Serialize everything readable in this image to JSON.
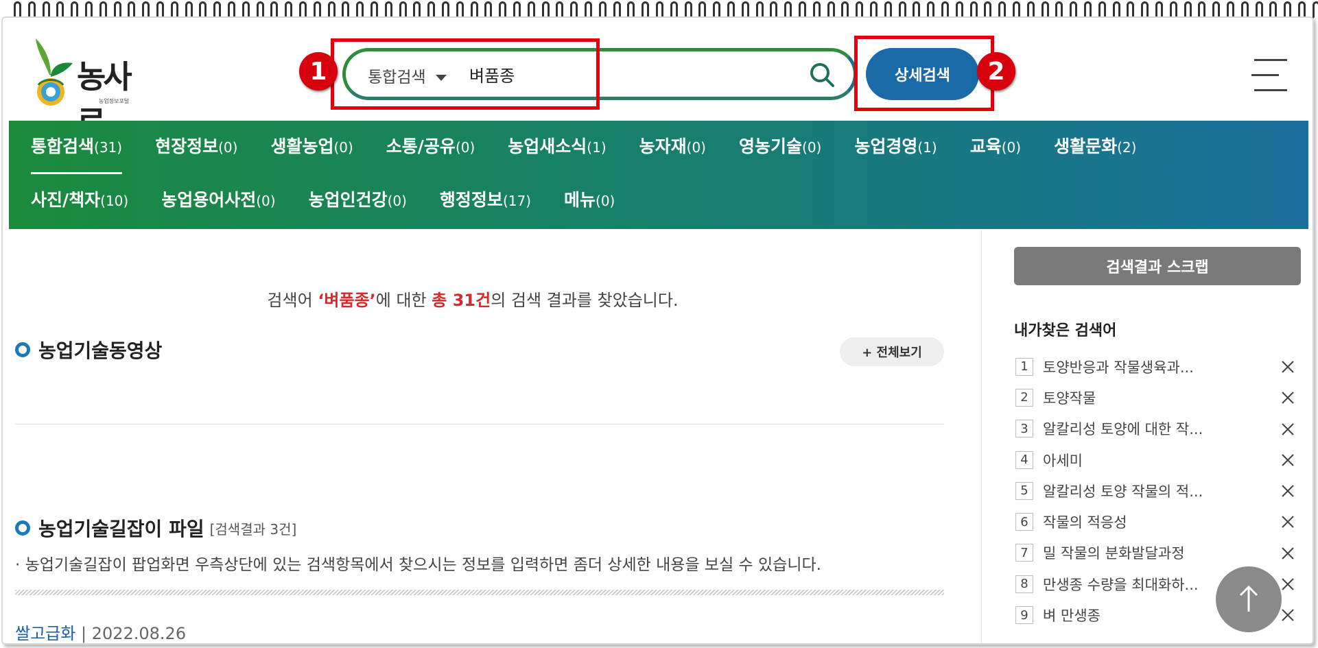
{
  "logo": {
    "text": "농사로",
    "sub": "농업정보포털"
  },
  "search": {
    "category": "통합검색",
    "value": "벼품종",
    "detail_button": "상세검색"
  },
  "annotations": {
    "badge1": "1",
    "badge2": "2"
  },
  "nav": {
    "row1": [
      {
        "label": "통합검색",
        "count": "(31)"
      },
      {
        "label": "현장정보",
        "count": "(0)"
      },
      {
        "label": "생활농업",
        "count": "(0)"
      },
      {
        "label": "소통/공유",
        "count": "(0)"
      },
      {
        "label": "농업새소식",
        "count": "(1)"
      },
      {
        "label": "농자재",
        "count": "(0)"
      },
      {
        "label": "영농기술",
        "count": "(0)"
      },
      {
        "label": "농업경영",
        "count": "(1)"
      },
      {
        "label": "교육",
        "count": "(0)"
      },
      {
        "label": "생활문화",
        "count": "(2)"
      }
    ],
    "row2": [
      {
        "label": "사진/책자",
        "count": "(10)"
      },
      {
        "label": "농업용어사전",
        "count": "(0)"
      },
      {
        "label": "농업인건강",
        "count": "(0)"
      },
      {
        "label": "행정정보",
        "count": "(17)"
      },
      {
        "label": "메뉴",
        "count": "(0)"
      }
    ]
  },
  "summary": {
    "prefix": "검색어 ",
    "keyword": "‘벼품종’",
    "middle": "에 대한 ",
    "total": "총 31건",
    "suffix": "의 검색 결과를 찾았습니다."
  },
  "sections": {
    "video_title": "농업기술동영상",
    "more_button": "+ 전체보기",
    "guide_title": "농업기술길잡이 파일",
    "guide_sub": "[검색결과 3건]",
    "guide_desc": "· 농업기술길잡이 팝업화면 우측상단에 있는 검색항목에서 찾으시는 정보를 입력하면 좀더 상세한 내용을 보실 수 있습니다.",
    "item_link": "쌀고급화",
    "item_sep": " | ",
    "item_date": "2022.08.26"
  },
  "sidebar": {
    "scrap_button": "검색결과 스크랩",
    "recent_title": "내가찾은 검색어",
    "recent": [
      {
        "num": "1",
        "text": "토양반응과 작물생육과..."
      },
      {
        "num": "2",
        "text": "토양작물"
      },
      {
        "num": "3",
        "text": "알칼리성 토양에 대한 작..."
      },
      {
        "num": "4",
        "text": "아세미"
      },
      {
        "num": "5",
        "text": "알칼리성 토양 작물의 적..."
      },
      {
        "num": "6",
        "text": "작물의 적응성"
      },
      {
        "num": "7",
        "text": "밀 작물의 분화발달과정"
      },
      {
        "num": "8",
        "text": "만생종 수량을 최대화하..."
      },
      {
        "num": "9",
        "text": "벼 만생종"
      }
    ]
  }
}
